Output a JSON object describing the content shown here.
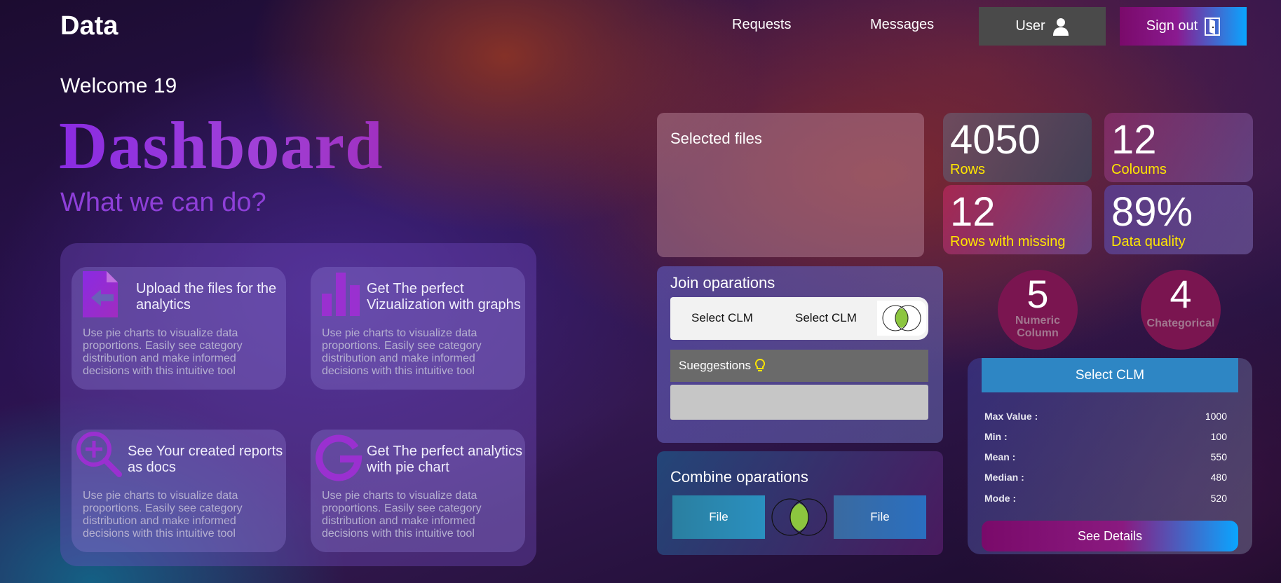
{
  "nav": {
    "brand": "Data",
    "links": [
      "Requests",
      "Messages"
    ],
    "user_label": "User",
    "signout_label": "Sign out"
  },
  "welcome": "Welcome 19",
  "title": "Dashboard",
  "subtitle": "What we can do?",
  "features": [
    {
      "title": "Upload the files for the analytics",
      "desc": "Use pie charts to visualize data proportions. Easily see category distribution and make informed decisions with this intuitive tool",
      "icon": "upload-file-icon"
    },
    {
      "title": "Get The perfect Vizualization with graphs",
      "desc": "Use pie charts to visualize data proportions. Easily see category distribution and make informed decisions with this intuitive tool",
      "icon": "bar-chart-icon"
    },
    {
      "title": "See Your created reports as docs",
      "desc": "Use pie charts to visualize data proportions. Easily see category distribution and make informed decisions with this intuitive tool",
      "icon": "zoom-in-icon"
    },
    {
      "title": "Get The perfect analytics with pie chart",
      "desc": "Use pie charts to visualize data proportions. Easily see category distribution and make informed decisions with this intuitive tool",
      "icon": "g-logo-icon"
    }
  ],
  "selected_files_label": "Selected files",
  "stats": [
    {
      "value": "4050",
      "label": "Rows"
    },
    {
      "value": "12",
      "label": "Coloums"
    },
    {
      "value": "12",
      "label": "Rows with missing"
    },
    {
      "value": "89%",
      "label": "Data quality"
    }
  ],
  "circles": [
    {
      "value": "5",
      "label": "Numeric Column"
    },
    {
      "value": "4",
      "label": "Chategorical"
    }
  ],
  "join": {
    "title": "Join oparations",
    "select1": "Select CLM",
    "select2": "Select CLM",
    "suggestions": "Sueggestions"
  },
  "combine": {
    "title": "Combine oparations",
    "file1": "File",
    "file2": "File"
  },
  "column_stats": {
    "header": "Select CLM",
    "rows": [
      {
        "label": "Max Value :",
        "value": "1000"
      },
      {
        "label": "Min :",
        "value": "100"
      },
      {
        "label": "Mean :",
        "value": "550"
      },
      {
        "label": "Median :",
        "value": "480"
      },
      {
        "label": "Mode :",
        "value": "520"
      }
    ],
    "button": "See Details"
  },
  "colors": {
    "accent_purple": "#8a2be2",
    "stat_label_yellow": "#ffe600",
    "venn_green": "#8cc63f"
  }
}
